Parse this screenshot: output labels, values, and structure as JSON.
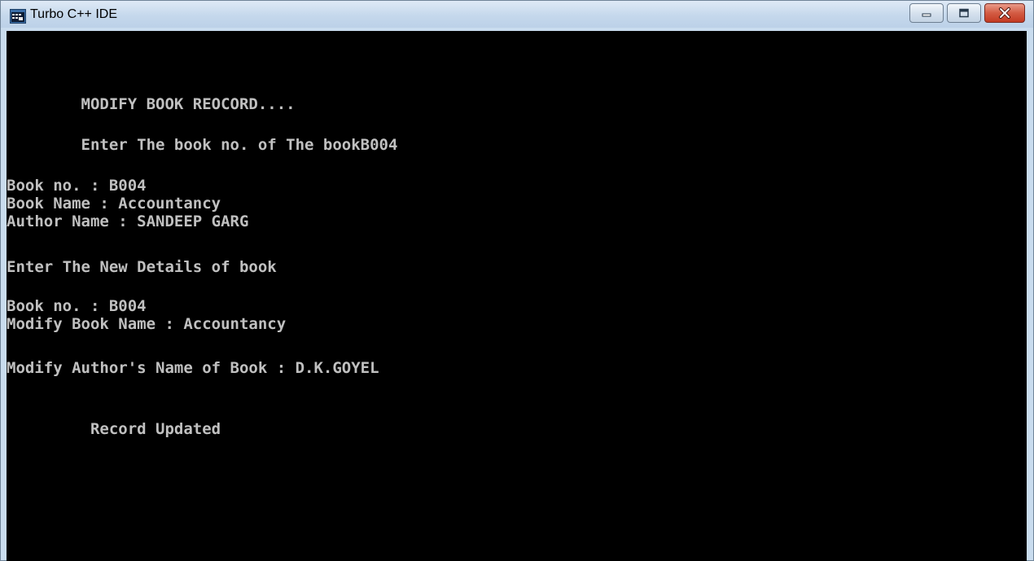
{
  "window": {
    "title": "Turbo C++ IDE",
    "icon": "msdos-console-icon"
  },
  "controls": {
    "minimize_icon": "minimize-icon",
    "maximize_icon": "maximize-icon",
    "close_icon": "close-icon",
    "close_color": "#c9432b"
  },
  "console": {
    "background": "#000000",
    "foreground": "#c0c0c0",
    "lines": [
      "        MODIFY BOOK REOCORD....",
      "        Enter The book no. of The bookB004",
      "Book no. : B004",
      "Book Name : Accountancy",
      "Author Name : SANDEEP GARG",
      "Enter The New Details of book",
      "Book no. : B004",
      "Modify Book Name : Accountancy",
      "Modify Author's Name of Book : D.K.GOYEL",
      "         Record Updated"
    ]
  }
}
